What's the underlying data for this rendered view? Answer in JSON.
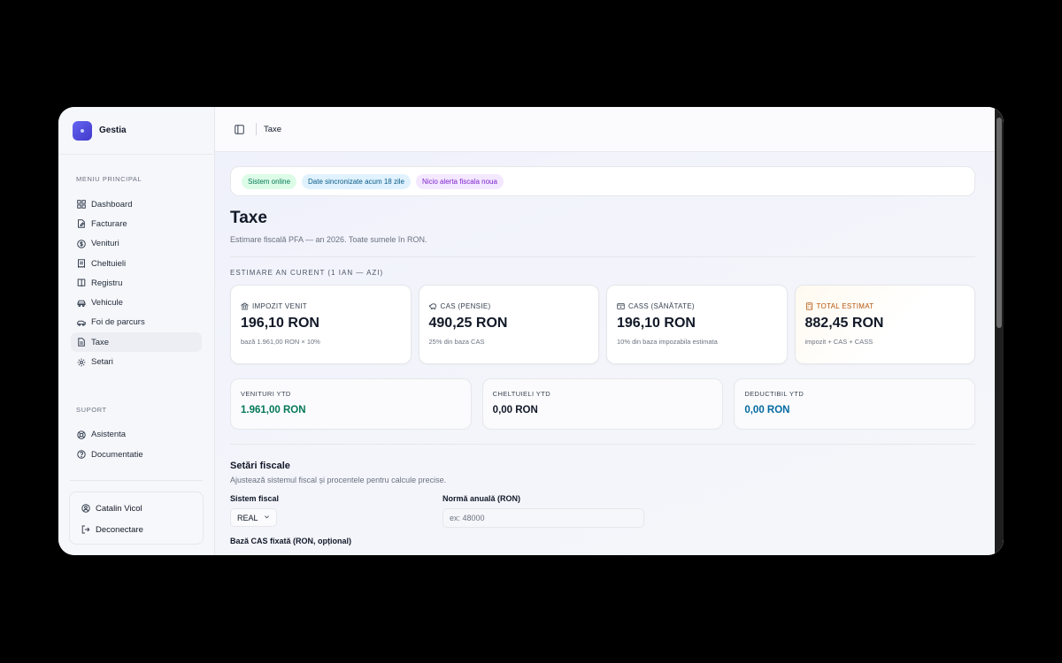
{
  "brand": {
    "name": "Gestia"
  },
  "sidebar": {
    "main_title": "MENIU PRINCIPAL",
    "items": [
      {
        "label": "Dashboard",
        "icon": "grid-icon"
      },
      {
        "label": "Facturare",
        "icon": "file-edit-icon"
      },
      {
        "label": "Venituri",
        "icon": "dollar-circle-icon"
      },
      {
        "label": "Cheltuieli",
        "icon": "receipt-icon"
      },
      {
        "label": "Registru",
        "icon": "book-icon"
      },
      {
        "label": "Vehicule",
        "icon": "car-icon"
      },
      {
        "label": "Foi de parcurs",
        "icon": "car-side-icon"
      },
      {
        "label": "Taxe",
        "icon": "document-icon",
        "active": true
      },
      {
        "label": "Setari",
        "icon": "gear-icon"
      }
    ],
    "support_title": "SUPORT",
    "support_items": [
      {
        "label": "Asistenta",
        "icon": "lifebuoy-icon"
      },
      {
        "label": "Documentatie",
        "icon": "help-circle-icon"
      }
    ],
    "user": {
      "name": "Catalin Vicol",
      "logout": "Deconectare"
    }
  },
  "topbar": {
    "breadcrumb": "Taxe"
  },
  "status": {
    "online": "Sistem online",
    "sync": "Date sincronizate acum 18 zile",
    "alerts": "Nicio alerta fiscala noua"
  },
  "page": {
    "title": "Taxe",
    "subtitle": "Estimare fiscală PFA — an 2026. Toate sumele în RON.",
    "section_label": "ESTIMARE AN CURENT (1 IAN — AZI)"
  },
  "cards": [
    {
      "label": "IMPOZIT VENIT",
      "value": "196,10 RON",
      "note": "bază 1.961,00 RON × 10%",
      "icon": "bank-icon"
    },
    {
      "label": "CAS (PENSIE)",
      "value": "490,25 RON",
      "note": "25% din baza CAS",
      "icon": "piggy-bank-icon"
    },
    {
      "label": "CASS (SĂNĂTATE)",
      "value": "196,10 RON",
      "note": "10% din baza impozabila estimata",
      "icon": "health-card-icon"
    },
    {
      "label": "TOTAL ESTIMAT",
      "value": "882,45 RON",
      "note": "impozit + CAS + CASS",
      "icon": "calculator-icon"
    }
  ],
  "ytd": [
    {
      "label": "VENITURI YTD",
      "value": "1.961,00 RON"
    },
    {
      "label": "CHELTUIELI YTD",
      "value": "0,00 RON"
    },
    {
      "label": "DEDUCTIBIL YTD",
      "value": "0,00 RON"
    }
  ],
  "settings": {
    "title": "Setări fiscale",
    "subtitle": "Ajustează sistemul fiscal și procentele pentru calcule precise.",
    "system_label": "Sistem fiscal",
    "system_value": "REAL",
    "norm_label": "Normă anuală (RON)",
    "norm_placeholder": "ex: 48000",
    "cas_base_label": "Bază CAS fixată (RON, opțional)"
  },
  "colors": {
    "accent": "#4f46e5",
    "positive": "#047857",
    "info": "#0369a1",
    "warning": "#b45309"
  }
}
